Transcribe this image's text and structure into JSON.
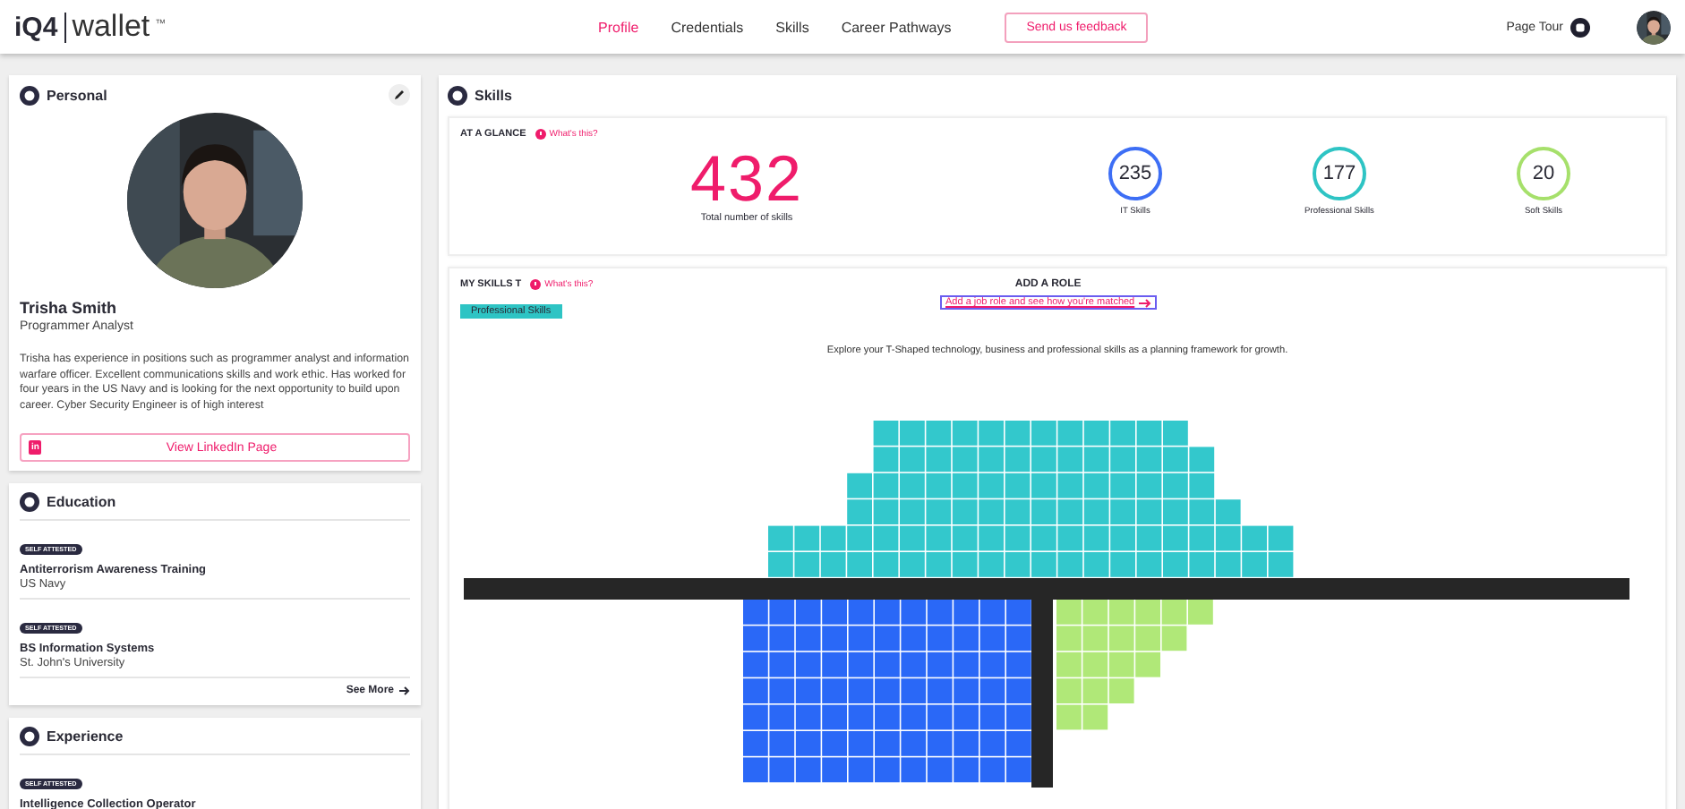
{
  "header": {
    "logo": {
      "brand": "iQ4",
      "product": "wallet",
      "mark": "™"
    },
    "nav": [
      {
        "label": "Profile",
        "selected": true
      },
      {
        "label": "Credentials",
        "selected": false
      },
      {
        "label": "Skills",
        "selected": false
      },
      {
        "label": "Career Pathways",
        "selected": false
      }
    ],
    "feedback_button": "Send us feedback",
    "page_tour": "Page Tour"
  },
  "personal": {
    "title": "Personal",
    "name": "Trisha Smith",
    "role": "Programmer Analyst",
    "bio": "Trisha has experience in positions such as programmer analyst and information warfare officer. Excellent communications skills and work ethic. Has worked for four years in the US Navy and is looking for the next opportunity to build upon career. Cyber Security Engineer is of high interest",
    "linkedin_button": "View LinkedIn Page",
    "linkedin_badge": "in"
  },
  "education": {
    "title": "Education",
    "items": [
      {
        "badge": "SELF ATTESTED",
        "title": "Antiterrorism Awareness Training",
        "org": "US Navy"
      },
      {
        "badge": "SELF ATTESTED",
        "title": "BS Information Systems",
        "org": "St. John's University"
      }
    ],
    "see_more": "See More"
  },
  "experience": {
    "title": "Experience",
    "items": [
      {
        "badge": "SELF ATTESTED",
        "title": "Intelligence Collection Operator"
      }
    ]
  },
  "skills": {
    "title": "Skills",
    "glance": {
      "title": "AT A GLANCE",
      "help": "What's this?",
      "total": "432",
      "total_label": "Total number of skills",
      "categories": [
        {
          "count": "235",
          "label": "IT Skills",
          "color": "#3d6ef5"
        },
        {
          "count": "177",
          "label": "Professional Skills",
          "color": "#2ec4c4"
        },
        {
          "count": "20",
          "label": "Soft Skills",
          "color": "#a6e06b"
        }
      ]
    },
    "t_chart": {
      "title": "MY SKILLS T",
      "help": "What's this?",
      "legend": "Professional Skills",
      "add_role_title": "ADD A ROLE",
      "add_role_link": "Add a job role and see how you're matched",
      "description": "Explore your T-Shaped technology, business and professional skills as a planning framework for growth."
    }
  }
}
